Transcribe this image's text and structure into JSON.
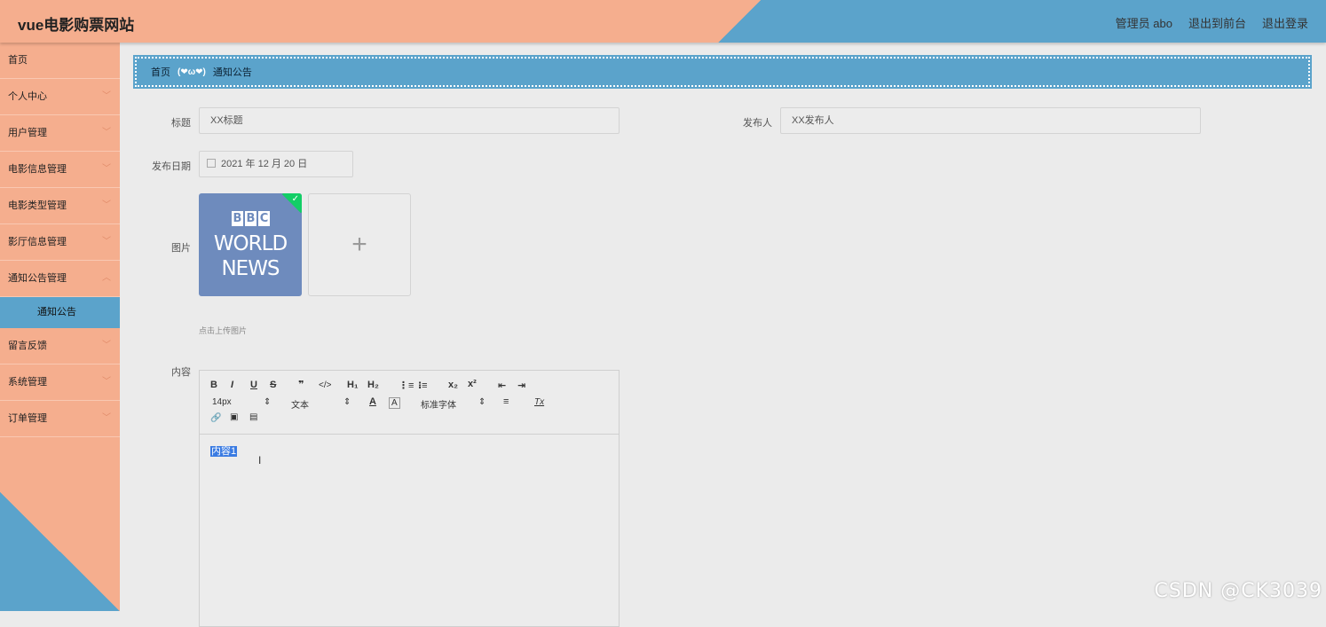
{
  "app": {
    "title": "vue电影购票网站"
  },
  "header": {
    "user": "管理员 abo",
    "front": "退出到前台",
    "logout": "退出登录"
  },
  "sidebar": {
    "items": [
      {
        "label": "首页"
      },
      {
        "label": "个人中心"
      },
      {
        "label": "用户管理"
      },
      {
        "label": "电影信息管理"
      },
      {
        "label": "电影类型管理"
      },
      {
        "label": "影厅信息管理"
      },
      {
        "label": "通知公告管理"
      },
      {
        "label": "通知公告"
      },
      {
        "label": "留言反馈"
      },
      {
        "label": "系统管理"
      },
      {
        "label": "订单管理"
      }
    ]
  },
  "breadcrumb": {
    "home": "首页",
    "sep": "(❤ω❤)",
    "current": "通知公告"
  },
  "form": {
    "title_label": "标题",
    "title_value": "XX标题",
    "publisher_label": "发布人",
    "publisher_value": "XX发布人",
    "date_label": "发布日期",
    "date_value": "2021 年 12 月 20 日",
    "image_label": "图片",
    "upload_hint": "点击上传图片",
    "content_label": "内容"
  },
  "image": {
    "bbc": [
      "B",
      "B",
      "C"
    ],
    "line1": "WORLD",
    "line2": "NEWS"
  },
  "editor": {
    "toolbar": {
      "bold": "B",
      "italic": "I",
      "underline": "U",
      "strike": "S",
      "quote": "❞",
      "code": "</>",
      "h1": "H₁",
      "h2": "H₂",
      "ol": "⋮≡",
      "ul": "⁝≡",
      "sub": "x₂",
      "sup": "x²",
      "outdent": "⇤",
      "indent": "⇥",
      "size": "14px",
      "header": "文本",
      "font": "标准字体",
      "color": "A",
      "bg": "A",
      "align": "≡",
      "clean": "Tx",
      "link": "🔗",
      "image": "▣",
      "video": "▤"
    },
    "content": "内容1"
  },
  "watermark": "CSDN @CK3039",
  "colors": {
    "peach": "#f5ae8e",
    "blue": "#5ba3cb",
    "bg": "#ebebeb"
  }
}
